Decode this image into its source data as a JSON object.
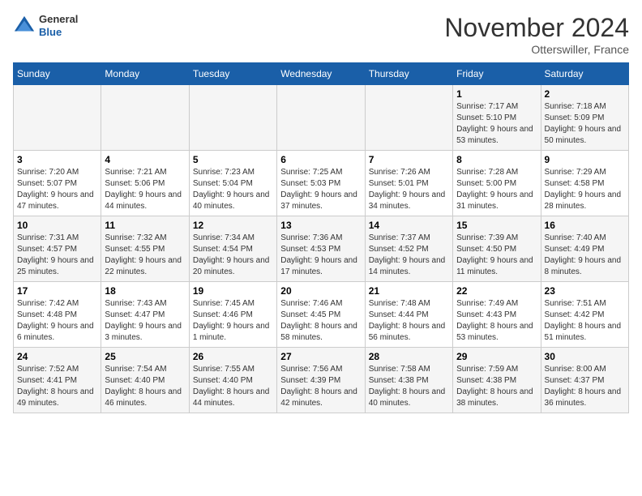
{
  "header": {
    "logo_line1": "General",
    "logo_line2": "Blue",
    "month_title": "November 2024",
    "location": "Otterswiller, France"
  },
  "weekdays": [
    "Sunday",
    "Monday",
    "Tuesday",
    "Wednesday",
    "Thursday",
    "Friday",
    "Saturday"
  ],
  "weeks": [
    [
      {
        "day": "",
        "sunrise": "",
        "sunset": "",
        "daylight": ""
      },
      {
        "day": "",
        "sunrise": "",
        "sunset": "",
        "daylight": ""
      },
      {
        "day": "",
        "sunrise": "",
        "sunset": "",
        "daylight": ""
      },
      {
        "day": "",
        "sunrise": "",
        "sunset": "",
        "daylight": ""
      },
      {
        "day": "",
        "sunrise": "",
        "sunset": "",
        "daylight": ""
      },
      {
        "day": "1",
        "sunrise": "Sunrise: 7:17 AM",
        "sunset": "Sunset: 5:10 PM",
        "daylight": "Daylight: 9 hours and 53 minutes."
      },
      {
        "day": "2",
        "sunrise": "Sunrise: 7:18 AM",
        "sunset": "Sunset: 5:09 PM",
        "daylight": "Daylight: 9 hours and 50 minutes."
      }
    ],
    [
      {
        "day": "3",
        "sunrise": "Sunrise: 7:20 AM",
        "sunset": "Sunset: 5:07 PM",
        "daylight": "Daylight: 9 hours and 47 minutes."
      },
      {
        "day": "4",
        "sunrise": "Sunrise: 7:21 AM",
        "sunset": "Sunset: 5:06 PM",
        "daylight": "Daylight: 9 hours and 44 minutes."
      },
      {
        "day": "5",
        "sunrise": "Sunrise: 7:23 AM",
        "sunset": "Sunset: 5:04 PM",
        "daylight": "Daylight: 9 hours and 40 minutes."
      },
      {
        "day": "6",
        "sunrise": "Sunrise: 7:25 AM",
        "sunset": "Sunset: 5:03 PM",
        "daylight": "Daylight: 9 hours and 37 minutes."
      },
      {
        "day": "7",
        "sunrise": "Sunrise: 7:26 AM",
        "sunset": "Sunset: 5:01 PM",
        "daylight": "Daylight: 9 hours and 34 minutes."
      },
      {
        "day": "8",
        "sunrise": "Sunrise: 7:28 AM",
        "sunset": "Sunset: 5:00 PM",
        "daylight": "Daylight: 9 hours and 31 minutes."
      },
      {
        "day": "9",
        "sunrise": "Sunrise: 7:29 AM",
        "sunset": "Sunset: 4:58 PM",
        "daylight": "Daylight: 9 hours and 28 minutes."
      }
    ],
    [
      {
        "day": "10",
        "sunrise": "Sunrise: 7:31 AM",
        "sunset": "Sunset: 4:57 PM",
        "daylight": "Daylight: 9 hours and 25 minutes."
      },
      {
        "day": "11",
        "sunrise": "Sunrise: 7:32 AM",
        "sunset": "Sunset: 4:55 PM",
        "daylight": "Daylight: 9 hours and 22 minutes."
      },
      {
        "day": "12",
        "sunrise": "Sunrise: 7:34 AM",
        "sunset": "Sunset: 4:54 PM",
        "daylight": "Daylight: 9 hours and 20 minutes."
      },
      {
        "day": "13",
        "sunrise": "Sunrise: 7:36 AM",
        "sunset": "Sunset: 4:53 PM",
        "daylight": "Daylight: 9 hours and 17 minutes."
      },
      {
        "day": "14",
        "sunrise": "Sunrise: 7:37 AM",
        "sunset": "Sunset: 4:52 PM",
        "daylight": "Daylight: 9 hours and 14 minutes."
      },
      {
        "day": "15",
        "sunrise": "Sunrise: 7:39 AM",
        "sunset": "Sunset: 4:50 PM",
        "daylight": "Daylight: 9 hours and 11 minutes."
      },
      {
        "day": "16",
        "sunrise": "Sunrise: 7:40 AM",
        "sunset": "Sunset: 4:49 PM",
        "daylight": "Daylight: 9 hours and 8 minutes."
      }
    ],
    [
      {
        "day": "17",
        "sunrise": "Sunrise: 7:42 AM",
        "sunset": "Sunset: 4:48 PM",
        "daylight": "Daylight: 9 hours and 6 minutes."
      },
      {
        "day": "18",
        "sunrise": "Sunrise: 7:43 AM",
        "sunset": "Sunset: 4:47 PM",
        "daylight": "Daylight: 9 hours and 3 minutes."
      },
      {
        "day": "19",
        "sunrise": "Sunrise: 7:45 AM",
        "sunset": "Sunset: 4:46 PM",
        "daylight": "Daylight: 9 hours and 1 minute."
      },
      {
        "day": "20",
        "sunrise": "Sunrise: 7:46 AM",
        "sunset": "Sunset: 4:45 PM",
        "daylight": "Daylight: 8 hours and 58 minutes."
      },
      {
        "day": "21",
        "sunrise": "Sunrise: 7:48 AM",
        "sunset": "Sunset: 4:44 PM",
        "daylight": "Daylight: 8 hours and 56 minutes."
      },
      {
        "day": "22",
        "sunrise": "Sunrise: 7:49 AM",
        "sunset": "Sunset: 4:43 PM",
        "daylight": "Daylight: 8 hours and 53 minutes."
      },
      {
        "day": "23",
        "sunrise": "Sunrise: 7:51 AM",
        "sunset": "Sunset: 4:42 PM",
        "daylight": "Daylight: 8 hours and 51 minutes."
      }
    ],
    [
      {
        "day": "24",
        "sunrise": "Sunrise: 7:52 AM",
        "sunset": "Sunset: 4:41 PM",
        "daylight": "Daylight: 8 hours and 49 minutes."
      },
      {
        "day": "25",
        "sunrise": "Sunrise: 7:54 AM",
        "sunset": "Sunset: 4:40 PM",
        "daylight": "Daylight: 8 hours and 46 minutes."
      },
      {
        "day": "26",
        "sunrise": "Sunrise: 7:55 AM",
        "sunset": "Sunset: 4:40 PM",
        "daylight": "Daylight: 8 hours and 44 minutes."
      },
      {
        "day": "27",
        "sunrise": "Sunrise: 7:56 AM",
        "sunset": "Sunset: 4:39 PM",
        "daylight": "Daylight: 8 hours and 42 minutes."
      },
      {
        "day": "28",
        "sunrise": "Sunrise: 7:58 AM",
        "sunset": "Sunset: 4:38 PM",
        "daylight": "Daylight: 8 hours and 40 minutes."
      },
      {
        "day": "29",
        "sunrise": "Sunrise: 7:59 AM",
        "sunset": "Sunset: 4:38 PM",
        "daylight": "Daylight: 8 hours and 38 minutes."
      },
      {
        "day": "30",
        "sunrise": "Sunrise: 8:00 AM",
        "sunset": "Sunset: 4:37 PM",
        "daylight": "Daylight: 8 hours and 36 minutes."
      }
    ]
  ]
}
